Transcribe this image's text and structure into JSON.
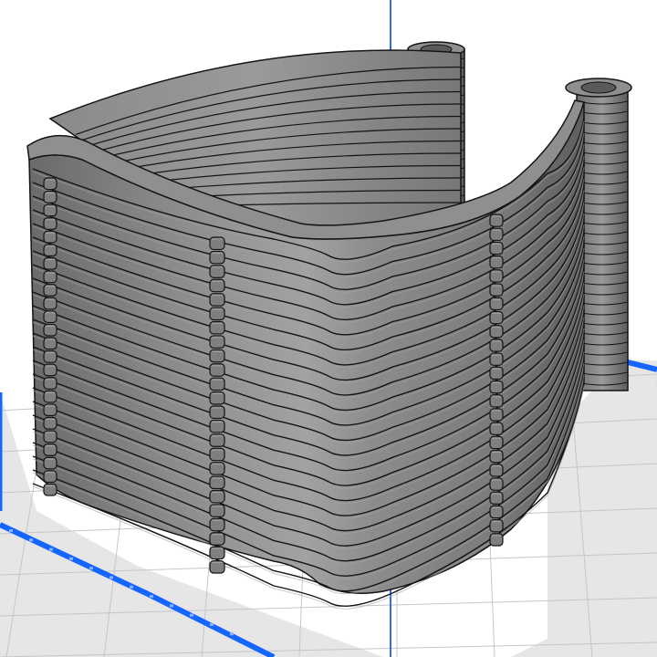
{
  "viewport": {
    "background_color": "#ffffff",
    "bed_fill_color": "#e6e6e6",
    "bed_grid_color": "#c4c6cc",
    "bed_border_color": "#1565ff",
    "axis_color": "#2f6cf0",
    "tick_color": "#8db2ff"
  },
  "model": {
    "name": "ribbed-curved-shell",
    "layer_count": 24,
    "body_color": "#7c7c7c",
    "highlight_color": "#a3a3a3",
    "shadow_color": "#4d4d4d",
    "outline_color": "#141414",
    "top_color": "#8f8f8f"
  }
}
